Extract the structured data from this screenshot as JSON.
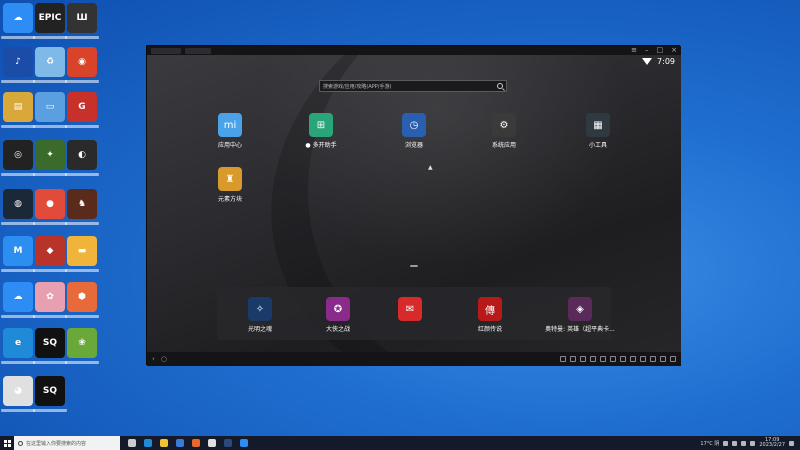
{
  "desktop": {
    "icons": [
      {
        "name": "baidu-netdisk-icon",
        "color": "#2e8df5",
        "glyph": "☁"
      },
      {
        "name": "epic-games-icon",
        "color": "#222222",
        "glyph": "EPIC"
      },
      {
        "name": "app-dark-icon",
        "color": "#333333",
        "glyph": "Ш"
      },
      {
        "name": "music-app-icon",
        "color": "#1b4da8",
        "glyph": "♪"
      },
      {
        "name": "recycle-bin-icon",
        "color": "#7fb9e8",
        "glyph": "♻"
      },
      {
        "name": "red-circle-app-icon",
        "color": "#d9432a",
        "glyph": "◉"
      },
      {
        "name": "document-app-icon",
        "color": "#d8a83a",
        "glyph": "▤"
      },
      {
        "name": "this-pc-icon",
        "color": "#5a9fe0",
        "glyph": "▭"
      },
      {
        "name": "red-g-app-icon",
        "color": "#c8302a",
        "glyph": "G"
      },
      {
        "name": "circle-game-icon",
        "color": "#222222",
        "glyph": "◎"
      },
      {
        "name": "wings-game-icon",
        "color": "#3b6b2a",
        "glyph": "✦"
      },
      {
        "name": "round-game-icon",
        "color": "#2a2a2a",
        "glyph": "◐"
      },
      {
        "name": "steam-icon",
        "color": "#1b2838",
        "glyph": "◍"
      },
      {
        "name": "red-circle-game-icon",
        "color": "#e24a3a",
        "glyph": "●"
      },
      {
        "name": "dark-game-icon",
        "color": "#5a2a1a",
        "glyph": "♞"
      },
      {
        "name": "emulator-logo-icon",
        "color": "#2b8ef0",
        "glyph": "M"
      },
      {
        "name": "small-game-icon",
        "color": "#b8342a",
        "glyph": "◆"
      },
      {
        "name": "yellow-folder-icon",
        "color": "#f0b43a",
        "glyph": "▬"
      },
      {
        "name": "cloud-app-icon",
        "color": "#2e8df5",
        "glyph": "☁"
      },
      {
        "name": "anime-game-icon",
        "color": "#e8a0b0",
        "glyph": "✿"
      },
      {
        "name": "map-pin-app-icon",
        "color": "#e86a3a",
        "glyph": "⬢"
      },
      {
        "name": "edge-icon",
        "color": "#1f8ad8",
        "glyph": "e"
      },
      {
        "name": "sq-game-icon",
        "color": "#111111",
        "glyph": "SQ"
      },
      {
        "name": "plants-game-icon",
        "color": "#6aa83a",
        "glyph": "❀"
      },
      {
        "name": "chrome-icon",
        "color": "#e0e0e0",
        "glyph": "◕"
      },
      {
        "name": "sq-game-2-icon",
        "color": "#111111",
        "glyph": "SQ"
      }
    ]
  },
  "emulator": {
    "time": "7:09",
    "search_placeholder": "搜索游戏/应用/攻略(APP/手游)",
    "apps": [
      {
        "label": "应用中心",
        "color": "#4aa3e8",
        "glyph": "mi"
      },
      {
        "label": "● 多开助手",
        "color": "#2aa57a",
        "glyph": "⊞"
      },
      {
        "label": "浏览器",
        "color": "#2a5fb0",
        "glyph": "◷"
      },
      {
        "label": "系统应用",
        "color": "#3a3a3a",
        "glyph": "⚙"
      },
      {
        "label": "小工具",
        "color": "#2f3a40",
        "glyph": "▦"
      },
      {
        "label": "元素方块",
        "color": "#d89a2a",
        "glyph": "♜"
      }
    ],
    "dock": [
      {
        "label": "光明之魂",
        "color": "#1a3a6a",
        "glyph": "✧"
      },
      {
        "label": "大侠之战",
        "color": "#8a2a8a",
        "glyph": "✪"
      },
      {
        "label": "",
        "color": "#d82a2a",
        "glyph": "✉"
      },
      {
        "label": "红颜传说",
        "color": "#b81a1a",
        "glyph": "傳"
      },
      {
        "label": "奥特曼: 英雄（超平典卡...",
        "color": "#5a2a5a",
        "glyph": "◈"
      }
    ]
  },
  "taskbar": {
    "search_placeholder": "在这里输入你要搜索的内容",
    "tray_temp": "17°C 阴",
    "tray_time": "17:09",
    "tray_date": "2023/2/27",
    "apps": [
      {
        "name": "task-view-icon",
        "color": "#cccccc"
      },
      {
        "name": "edge-taskbar-icon",
        "color": "#1f8ad8"
      },
      {
        "name": "file-explorer-icon",
        "color": "#f0c23a"
      },
      {
        "name": "mail-icon",
        "color": "#3a7ad8"
      },
      {
        "name": "firefox-icon",
        "color": "#e8692a"
      },
      {
        "name": "chrome-taskbar-icon",
        "color": "#e0e0e0"
      },
      {
        "name": "steam-taskbar-icon",
        "color": "#2a4a7a"
      },
      {
        "name": "emulator-taskbar-icon",
        "color": "#2b8ef0"
      }
    ]
  }
}
